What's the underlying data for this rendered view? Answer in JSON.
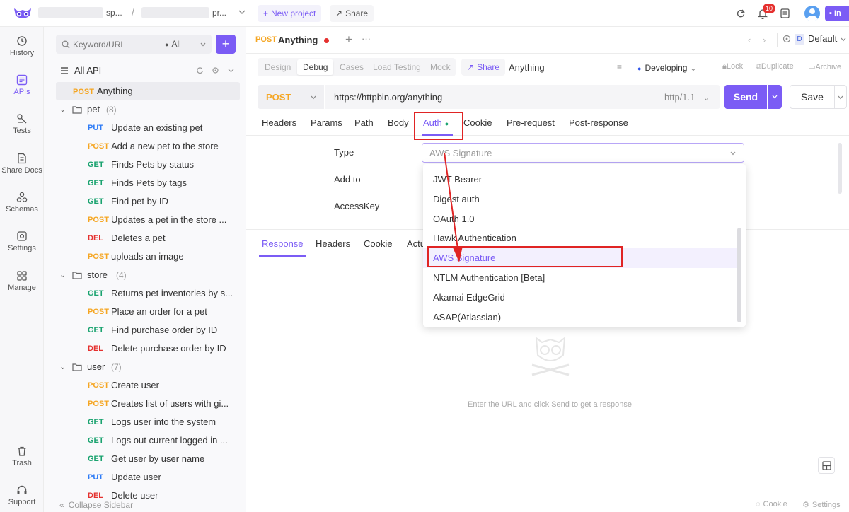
{
  "topbar": {
    "workspace_name": "sp...",
    "project_name": "pr...",
    "new_project_label": "New project",
    "share_label": "Share",
    "notification_count": "10",
    "user_initial": "In"
  },
  "rail": {
    "items": [
      {
        "label": "History"
      },
      {
        "label": "APIs"
      },
      {
        "label": "Tests"
      },
      {
        "label": "Share Docs"
      },
      {
        "label": "Schemas"
      },
      {
        "label": "Settings"
      },
      {
        "label": "Manage"
      }
    ],
    "bottom": [
      {
        "label": "Trash"
      },
      {
        "label": "Support"
      }
    ]
  },
  "sidebar": {
    "search_placeholder": "Keyword/URL",
    "filter_value": "All",
    "root_label": "All API",
    "selected": {
      "method": "POST",
      "name": "Anything"
    },
    "groups": [
      {
        "name": "pet",
        "count": "(8)",
        "items": [
          {
            "method": "PUT",
            "name": "Update an existing pet"
          },
          {
            "method": "POST",
            "name": "Add a new pet to the store"
          },
          {
            "method": "GET",
            "name": "Finds Pets by status"
          },
          {
            "method": "GET",
            "name": "Finds Pets by tags"
          },
          {
            "method": "GET",
            "name": "Find pet by ID"
          },
          {
            "method": "POST",
            "name": "Updates a pet in the store ..."
          },
          {
            "method": "DEL",
            "name": "Deletes a pet"
          },
          {
            "method": "POST",
            "name": "uploads an image"
          }
        ]
      },
      {
        "name": "store",
        "count": "(4)",
        "items": [
          {
            "method": "GET",
            "name": "Returns pet inventories by s..."
          },
          {
            "method": "POST",
            "name": "Place an order for a pet"
          },
          {
            "method": "GET",
            "name": "Find purchase order by ID"
          },
          {
            "method": "DEL",
            "name": "Delete purchase order by ID"
          }
        ]
      },
      {
        "name": "user",
        "count": "(7)",
        "items": [
          {
            "method": "POST",
            "name": "Create user"
          },
          {
            "method": "POST",
            "name": "Creates list of users with gi..."
          },
          {
            "method": "GET",
            "name": "Logs user into the system"
          },
          {
            "method": "GET",
            "name": "Logs out current logged in ..."
          },
          {
            "method": "GET",
            "name": "Get user by user name"
          },
          {
            "method": "PUT",
            "name": "Update user"
          },
          {
            "method": "DEL",
            "name": "Delete user"
          }
        ]
      }
    ],
    "collapse_label": "Collapse Sidebar"
  },
  "tabbar": {
    "tab_method": "POST",
    "tab_name": "Anything",
    "env_letter": "D",
    "env_name": "Default"
  },
  "modes": [
    "Design",
    "Debug",
    "Cases",
    "Load Testing",
    "Mock"
  ],
  "toolbar": {
    "share_label": "Share",
    "api_name": "Anything",
    "status": "Developing",
    "lock": "Lock",
    "duplicate": "Duplicate",
    "archive": "Archive"
  },
  "request": {
    "method": "POST",
    "url": "https://httpbin.org/anything",
    "protocol": "http/1.1",
    "send_label": "Send",
    "save_label": "Save"
  },
  "req_tabs": [
    "Headers",
    "Params",
    "Path",
    "Body",
    "Auth",
    "Cookie",
    "Pre-request",
    "Post-response"
  ],
  "auth": {
    "type_label": "Type",
    "type_value": "AWS Signature",
    "add_to_label": "Add to",
    "access_key_label": "AccessKey",
    "options": [
      "JWT Bearer",
      "Digest auth",
      "OAuth 1.0",
      "Hawk Authentication",
      "AWS Signature",
      "NTLM Authentication [Beta]",
      "Akamai EdgeGrid",
      "ASAP(Atlassian)"
    ]
  },
  "resp_tabs": [
    "Response",
    "Headers",
    "Cookie",
    "Actu"
  ],
  "empty_text": "Enter the URL and click Send to get a response",
  "footer": {
    "cookie": "Cookie",
    "settings": "Settings"
  }
}
